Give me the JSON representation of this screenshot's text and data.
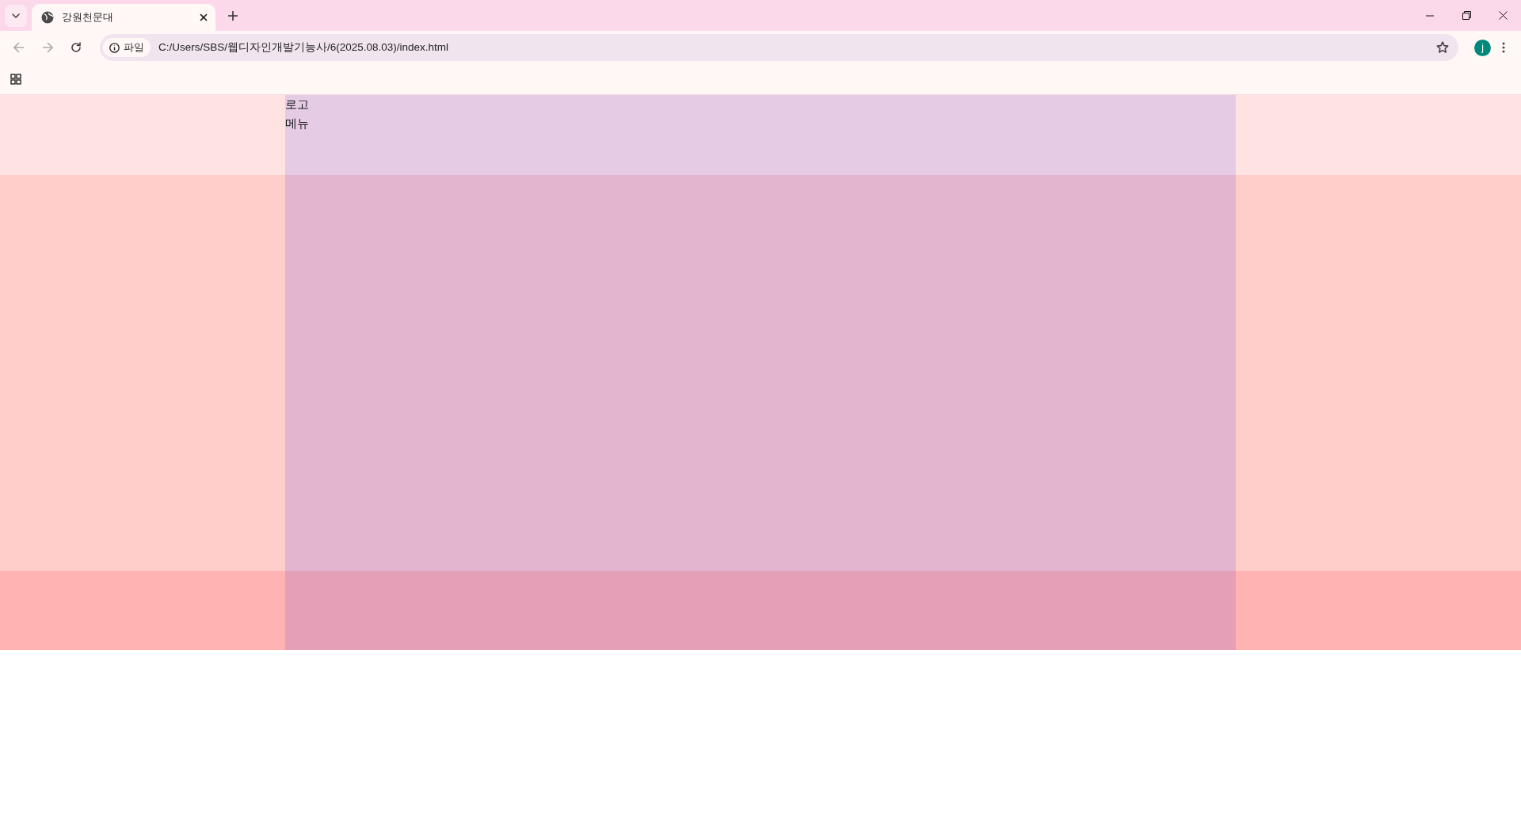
{
  "browser": {
    "tabs": [
      {
        "title": "강원천문대",
        "selected": true
      }
    ],
    "address_bar": {
      "security_label": "파일",
      "url": "C:/Users/SBS/웹디자인개발기능사/6(2025.08.03)/index.html"
    },
    "profile": {
      "initial": "j"
    }
  },
  "page": {
    "header": {
      "logo": "로고",
      "menu": "메뉴"
    }
  }
}
